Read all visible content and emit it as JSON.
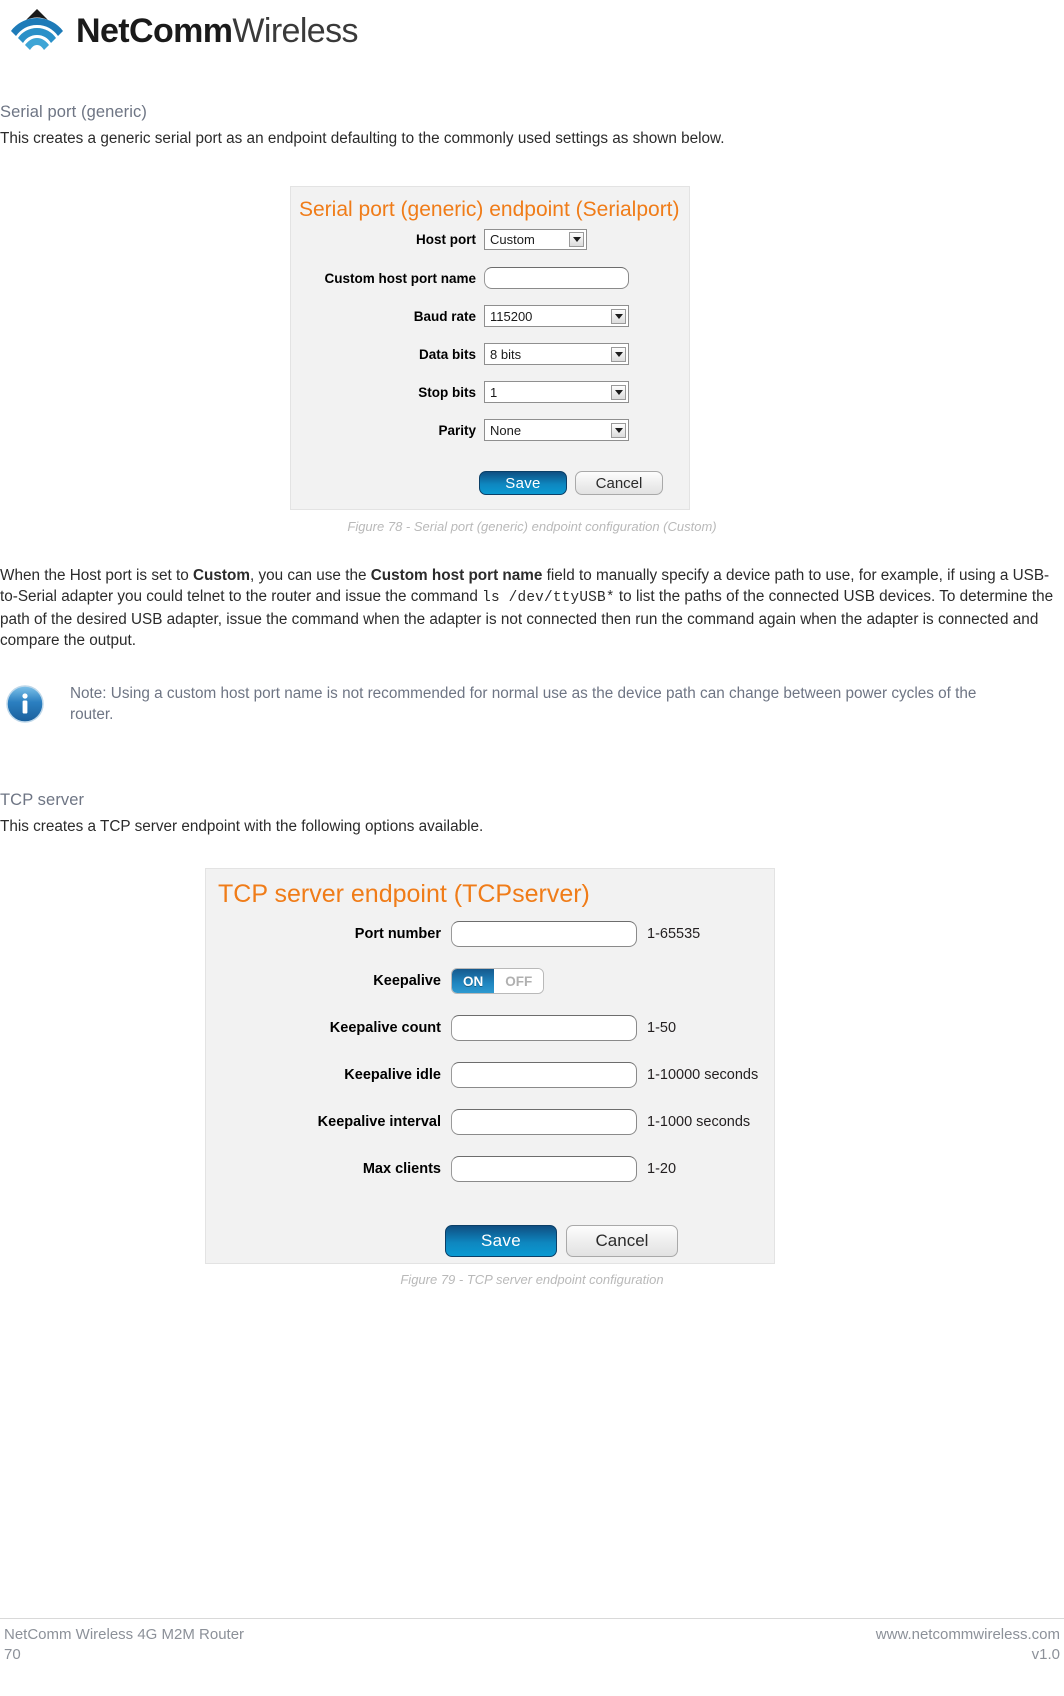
{
  "header": {
    "logo_bold": "NetComm",
    "logo_light": "Wireless",
    "logo_icon": "wifi-waves-icon"
  },
  "sections": {
    "serial": {
      "heading": "Serial port (generic)",
      "intro": "This creates a generic serial port as an endpoint defaulting to the commonly used settings as shown below.",
      "figure_caption": "Figure 78 - Serial port (generic) endpoint configuration (Custom)"
    },
    "tcp": {
      "heading": "TCP server",
      "intro": "This creates a TCP server endpoint with the following options available.",
      "figure_caption": "Figure 79 - TCP server endpoint configuration"
    }
  },
  "serial_panel": {
    "title": "Serial port (generic) endpoint (Serialport)",
    "fields": [
      {
        "label": "Host port",
        "type": "select",
        "value": "Custom"
      },
      {
        "label": "Custom host port name",
        "type": "text",
        "value": ""
      },
      {
        "label": "Baud rate",
        "type": "select",
        "value": "115200"
      },
      {
        "label": "Data bits",
        "type": "select",
        "value": "8 bits"
      },
      {
        "label": "Stop bits",
        "type": "select",
        "value": "1"
      },
      {
        "label": "Parity",
        "type": "select",
        "value": "None"
      }
    ],
    "save_label": "Save",
    "cancel_label": "Cancel"
  },
  "tcp_panel": {
    "title": "TCP server endpoint (TCPserver)",
    "fields": [
      {
        "label": "Port number",
        "type": "text",
        "value": "",
        "hint": "1-65535"
      },
      {
        "label": "Keepalive",
        "type": "toggle",
        "on_label": "ON",
        "off_label": "OFF",
        "state": "ON",
        "hint": ""
      },
      {
        "label": "Keepalive count",
        "type": "text",
        "value": "",
        "hint": "1-50"
      },
      {
        "label": "Keepalive idle",
        "type": "text",
        "value": "",
        "hint": "1-10000  seconds"
      },
      {
        "label": "Keepalive interval",
        "type": "text",
        "value": "",
        "hint": "1-1000  seconds"
      },
      {
        "label": "Max clients",
        "type": "text",
        "value": "",
        "hint": "1-20"
      }
    ],
    "save_label": "Save",
    "cancel_label": "Cancel"
  },
  "paragraph": {
    "part1": "When the Host port is set to ",
    "bold1": "Custom",
    "part2": ", you can use the ",
    "bold2": "Custom host port name",
    "part3": " field to manually specify a device path to use, for example, if using a USB-to-Serial adapter you could telnet to the router and issue the command ",
    "command": "ls /dev/ttyUSB*",
    "part4": " to list the paths of the connected USB devices. To determine the path of the desired USB adapter, issue the command when the adapter is not connected then run the command again when the adapter is connected and compare the output."
  },
  "note": {
    "icon": "info-circle-icon",
    "text": "Note: Using a custom host port name is not recommended for normal use as the device path can change between power cycles of the router."
  },
  "footer": {
    "left_top": "NetComm Wireless 4G M2M Router",
    "left_bottom": "70",
    "right_top": "www.netcommwireless.com",
    "right_bottom": "v1.0"
  },
  "colors": {
    "accent_orange": "#f07c18",
    "brand_blue": "#1f86c0",
    "heading_grey": "#6e7584",
    "caption_grey": "#b9b9b9"
  }
}
